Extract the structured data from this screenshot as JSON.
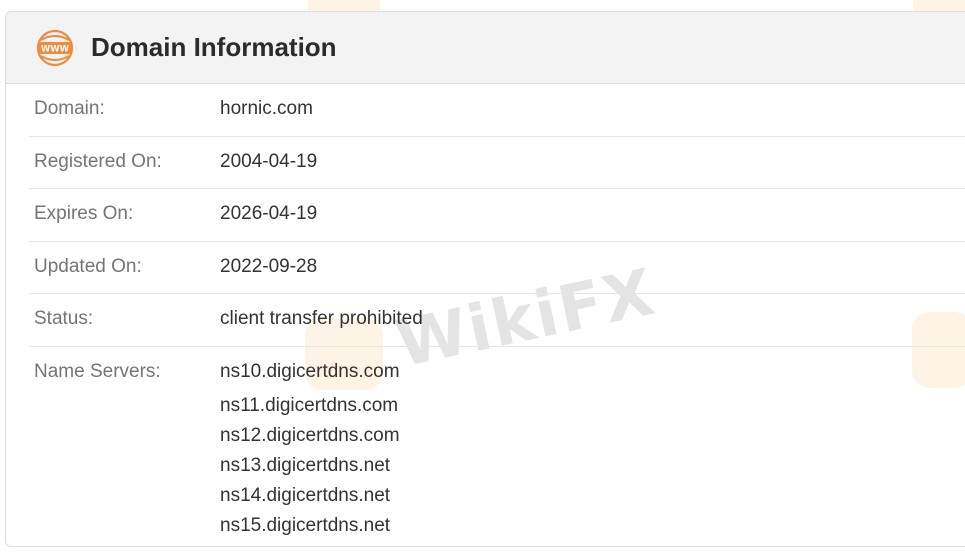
{
  "header": {
    "title": "Domain Information",
    "icon": "www-globe-icon",
    "icon_text": "WWW",
    "accent_color": "#f08a3c"
  },
  "rows": [
    {
      "label": "Domain:",
      "value": "hornic.com"
    },
    {
      "label": "Registered On:",
      "value": "2004-04-19"
    },
    {
      "label": "Expires On:",
      "value": "2026-04-19"
    },
    {
      "label": "Updated On:",
      "value": "2022-09-28"
    },
    {
      "label": "Status:",
      "value": "client transfer prohibited"
    }
  ],
  "name_servers": {
    "label": "Name Servers:",
    "values": [
      "ns10.digicertdns.com",
      "ns11.digicertdns.com",
      "ns12.digicertdns.com",
      "ns13.digicertdns.net",
      "ns14.digicertdns.net",
      "ns15.digicertdns.net"
    ]
  },
  "watermark": {
    "text": "WikiFX"
  }
}
